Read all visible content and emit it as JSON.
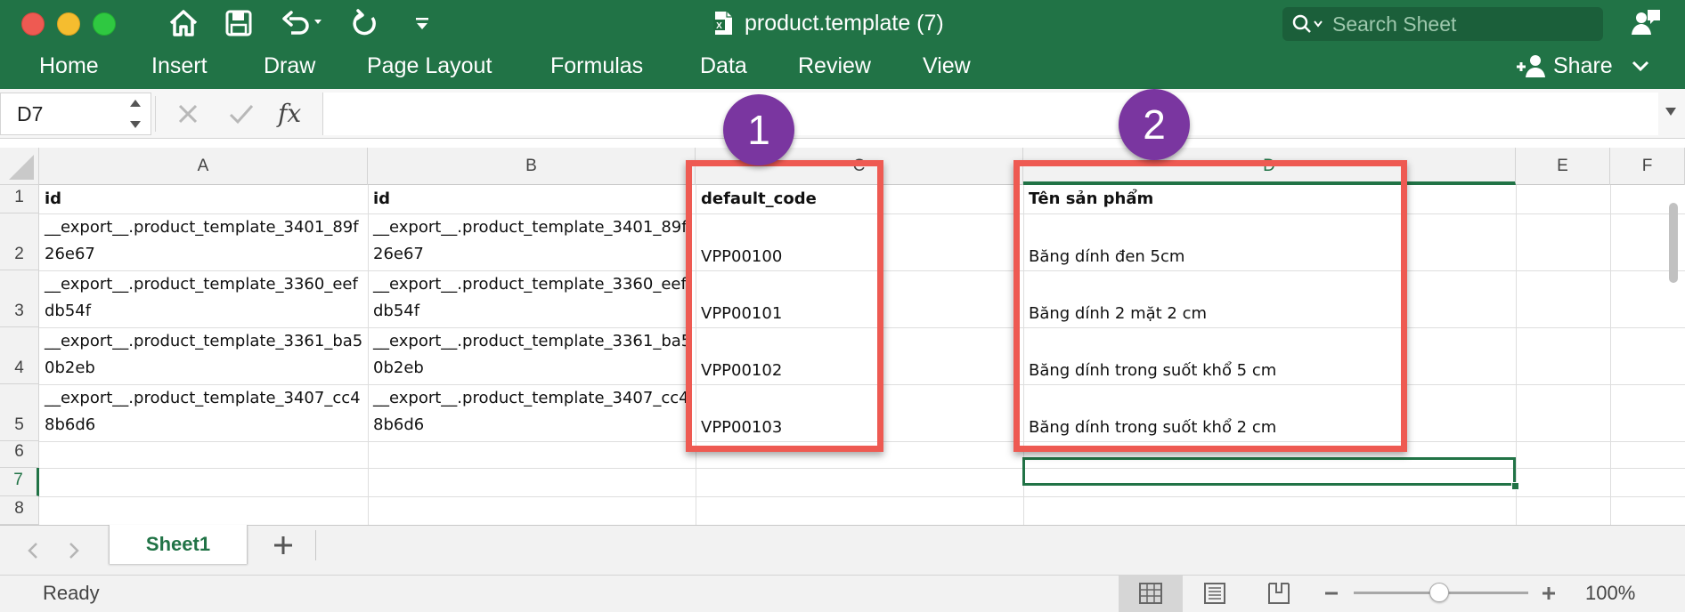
{
  "window": {
    "title": "product.template (7)",
    "search_placeholder": "Search Sheet",
    "share_label": "Share"
  },
  "ribbon": {
    "tabs": [
      "Home",
      "Insert",
      "Draw",
      "Page Layout",
      "Formulas",
      "Data",
      "Review",
      "View"
    ]
  },
  "formula_bar": {
    "name_box": "D7",
    "fx_label": "fx",
    "formula": ""
  },
  "grid": {
    "columns": [
      "A",
      "B",
      "C",
      "D",
      "E",
      "F"
    ],
    "rows": [
      "1",
      "2",
      "3",
      "4",
      "5",
      "6",
      "7",
      "8"
    ],
    "cells": {
      "A1": "id",
      "B1": "id",
      "C1": "default_code",
      "D1": "Tên sản phẩm",
      "A2": "__export__.product_template_3401_89f26e67",
      "B2": "__export__.product_template_3401_89f26e67",
      "C2": "VPP00100",
      "D2": "Băng dính đen 5cm",
      "A3": "__export__.product_template_3360_eefdb54f",
      "B3": "__export__.product_template_3360_eefdb54f",
      "C3": "VPP00101",
      "D3": "Băng dính 2 mặt 2 cm",
      "A4": "__export__.product_template_3361_ba50b2eb",
      "B4": "__export__.product_template_3361_ba50b2eb",
      "C4": "VPP00102",
      "D4": "Băng dính trong suốt khổ 5 cm",
      "A5": "__export__.product_template_3407_cc48b6d6",
      "B5": "__export__.product_template_3407_cc48b6d6",
      "C5": "VPP00103",
      "D5": "Băng dính trong suốt khổ 2 cm"
    },
    "selected_cell": "D7"
  },
  "annotations": [
    {
      "label": "1",
      "target": "default_code column"
    },
    {
      "label": "2",
      "target": "Tên sản phẩm column"
    }
  ],
  "sheets": {
    "tabs": [
      "Sheet1"
    ],
    "active": "Sheet1",
    "add_label": "+"
  },
  "status": {
    "text": "Ready",
    "zoom_level": 1.0,
    "zoom_text": "100%"
  },
  "colors": {
    "accent": "#217346",
    "highlight": "#ee5a52",
    "badge": "#7a36a0"
  },
  "icons": [
    "home-icon",
    "save-icon",
    "undo-icon",
    "redo-icon",
    "customize-toolbar-icon",
    "excel-file-icon",
    "search-icon",
    "feedback-icon",
    "add-person-icon",
    "chevron-down-icon",
    "cancel-icon",
    "enter-icon",
    "normal-view-icon",
    "page-layout-view-icon",
    "page-break-view-icon"
  ]
}
